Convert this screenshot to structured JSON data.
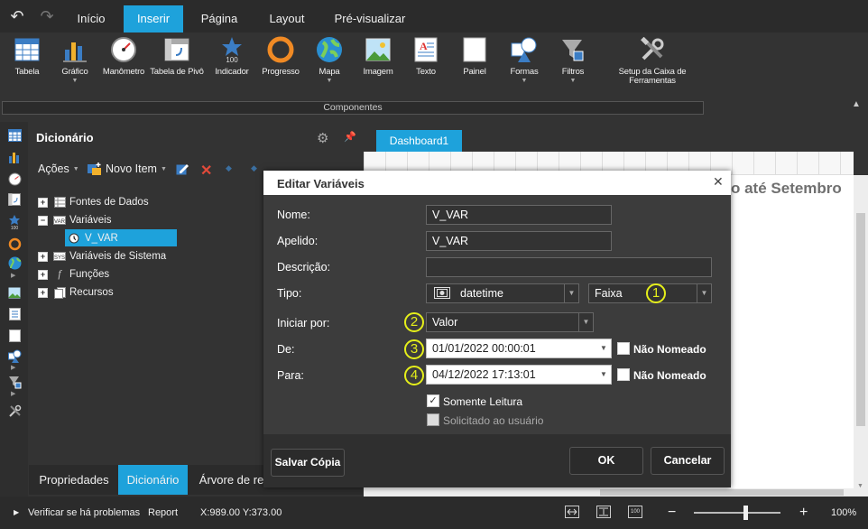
{
  "menu": {
    "tabs": [
      "Início",
      "Inserir",
      "Página",
      "Layout",
      "Pré-visualizar"
    ],
    "active": "Inserir"
  },
  "ribbon": {
    "items": [
      {
        "label": "Tabela",
        "icon": "table-icon"
      },
      {
        "label": "Gráfico",
        "icon": "chart-icon"
      },
      {
        "label": "Manômetro",
        "icon": "gauge-icon"
      },
      {
        "label": "Tabela de Pivô",
        "icon": "pivot-table-icon"
      },
      {
        "label": "Indicador",
        "icon": "indicator-icon",
        "value": "100"
      },
      {
        "label": "Progresso",
        "icon": "progress-icon"
      },
      {
        "label": "Mapa",
        "icon": "globe-icon"
      },
      {
        "label": "Imagem",
        "icon": "image-icon"
      },
      {
        "label": "Texto",
        "icon": "text-icon"
      },
      {
        "label": "Painel",
        "icon": "panel-icon"
      },
      {
        "label": "Formas",
        "icon": "shapes-icon"
      },
      {
        "label": "Filtros",
        "icon": "filter-icon"
      },
      {
        "label": "Setup da Caixa de Ferramentas",
        "icon": "tools-icon"
      }
    ],
    "group_label": "Componentes"
  },
  "dictionary": {
    "title": "Dicionário",
    "actions_label": "Ações",
    "new_item_label": "Novo Item",
    "tree": [
      {
        "label": "Fontes de Dados",
        "expanded": false
      },
      {
        "label": "Variáveis",
        "expanded": true
      },
      {
        "label": "V_VAR",
        "selected": true
      },
      {
        "label": "Variáveis de Sistema",
        "expanded": false
      },
      {
        "label": "Funções",
        "expanded": false
      },
      {
        "label": "Recursos",
        "expanded": false
      }
    ],
    "tabs": [
      "Propriedades",
      "Dicionário",
      "Árvore de rel"
    ],
    "active_tab": "Dicionário"
  },
  "designer": {
    "tab": "Dashboard1",
    "background_text": "o até Setembro"
  },
  "dialog": {
    "title": "Editar Variáveis",
    "fields": {
      "nome_label": "Nome:",
      "nome_value": "V_VAR",
      "apelido_label": "Apelido:",
      "apelido_value": "V_VAR",
      "descricao_label": "Descrição:",
      "descricao_value": "",
      "tipo_label": "Tipo:",
      "tipo_value": "datetime",
      "tipo_mode": "Faixa",
      "iniciar_label": "Iniciar por:",
      "iniciar_value": "Valor",
      "de_label": "De:",
      "de_value": "01/01/2022 00:00:01",
      "para_label": "Para:",
      "para_value": "04/12/2022 17:13:01",
      "nao_nomeado": "Não Nomeado",
      "somente_leitura": "Somente Leitura",
      "solicitado": "Solicitado ao usuário"
    },
    "checks": {
      "de_unnamed": false,
      "para_unnamed": false,
      "read_only": true,
      "request_user": false
    },
    "badges": [
      "1",
      "2",
      "3",
      "4"
    ],
    "buttons": {
      "save_copy": "Salvar Cópia",
      "ok": "OK",
      "cancel": "Cancelar"
    }
  },
  "status": {
    "check_label": "Verificar se há problemas",
    "report_label": "Report",
    "coords": "X:989.00 Y:373.00",
    "zoom": "100%",
    "zoom_level": 0.6
  },
  "colors": {
    "accent": "#1ea2db",
    "badge": "#e5ef1a"
  }
}
